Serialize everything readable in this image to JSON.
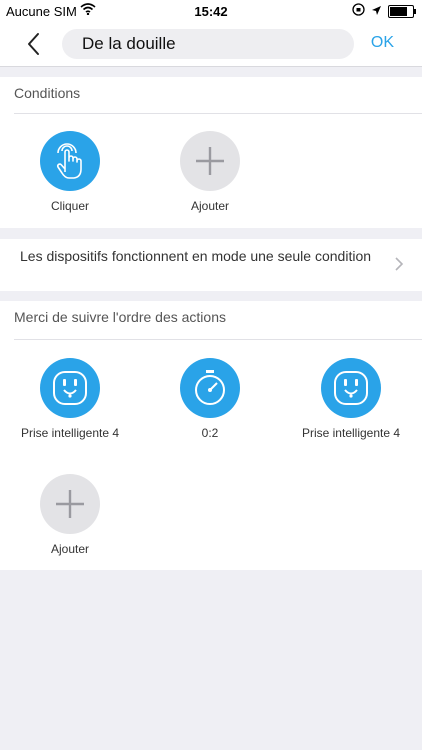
{
  "status_bar": {
    "carrier": "Aucune SIM",
    "time": "15:42",
    "battery_level": 0.85
  },
  "nav": {
    "title_value": "De la douille",
    "ok_label": "OK"
  },
  "conditions": {
    "title": "Conditions",
    "items": [
      {
        "label": "Cliquer",
        "icon": "tap-hand-icon",
        "color": "#2aa3e8"
      },
      {
        "label": "Ajouter",
        "icon": "plus-icon",
        "color": "#e3e3e6"
      }
    ]
  },
  "mode_row": {
    "text": "Les dispositifs fonctionnent en mode une seule condition"
  },
  "actions": {
    "title": "Merci de suivre l'ordre des actions",
    "items": [
      {
        "label": "Prise intelligente 4",
        "icon": "smart-plug-icon"
      },
      {
        "label": "0:2",
        "icon": "timer-icon"
      },
      {
        "label": "Prise intelligente 4",
        "icon": "smart-plug-icon"
      },
      {
        "label": "Ajouter",
        "icon": "plus-icon"
      }
    ]
  },
  "colors": {
    "accent": "#2aa3e8",
    "background": "#efeff4"
  }
}
